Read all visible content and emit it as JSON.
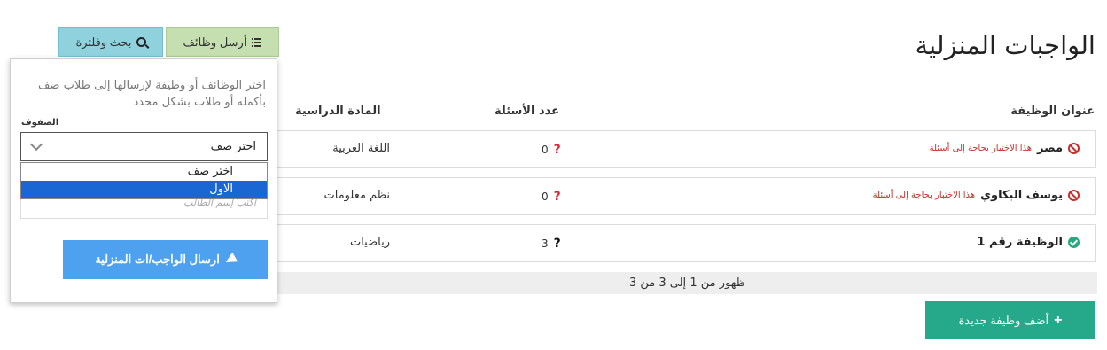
{
  "page_title": "الواجبات المنزلية",
  "toolbar": {
    "send_jobs_label": "أرسل وظائف",
    "search_filter_label": "بحث وفلترة"
  },
  "table": {
    "headers": {
      "title": "عنوان الوظيفة",
      "questions_count": "عدد الأسئلة",
      "subject": "المادة الدراسية"
    },
    "rows": [
      {
        "name": "مصر",
        "status": "incomplete",
        "warning": "هذا الاختبار بحاجة إلى أسئلة",
        "question_mark": "?",
        "count": "0",
        "subject": "اللغة العربية"
      },
      {
        "name": "يوسف البكاوي",
        "status": "incomplete",
        "warning": "هذا الاختبار بحاجة إلى أسئلة",
        "question_mark": "?",
        "count": "0",
        "subject": "نظم معلومات"
      },
      {
        "name": "الوظيفة رقم 1",
        "status": "ready",
        "warning": "",
        "question_mark": "?",
        "count": "3",
        "subject": "رياضيات"
      }
    ],
    "footer_info": "ظهور من 1 إلى 3 من 3"
  },
  "add_button_label": "أضف وظيفة جديدة",
  "send_panel": {
    "description": "اختر الوظائف أو وظيفة لإرسالها إلى طلاب صف بأكمله أو طلاب بشكل محدد",
    "classes_label": "الصفوف",
    "class_select_value": "اختر صف",
    "class_options": [
      "اختر صف",
      "الاول"
    ],
    "student_placeholder": "أكتب إسم الطالب",
    "send_button_label": "ارسال الواجب/ات المنزلية"
  },
  "colors": {
    "accent_green": "#26a98a",
    "send_blue": "#4da1ef",
    "warning_red": "#c9302c",
    "selected_option": "#1a66d2"
  }
}
